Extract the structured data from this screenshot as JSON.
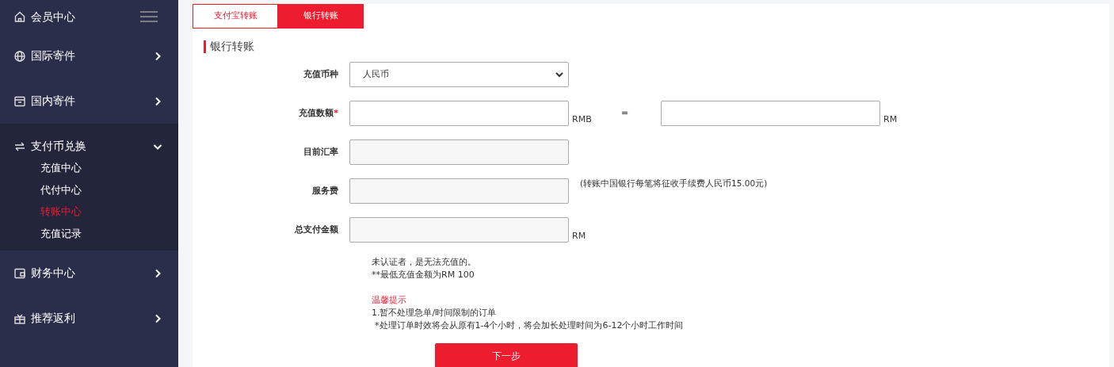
{
  "sidebar": {
    "header": {
      "label": "会员中心"
    },
    "items": [
      {
        "label": "国际寄件",
        "expanded": false
      },
      {
        "label": "国内寄件",
        "expanded": false
      },
      {
        "label": "支付币兑换",
        "expanded": true,
        "children": [
          {
            "label": "充值中心",
            "selected": false
          },
          {
            "label": "代付中心",
            "selected": false
          },
          {
            "label": "转账中心",
            "selected": true
          },
          {
            "label": "充值记录",
            "selected": false
          }
        ]
      },
      {
        "label": "财务中心",
        "expanded": false
      },
      {
        "label": "推荐返利",
        "expanded": false
      }
    ]
  },
  "tabs": [
    {
      "label": "支付宝转账",
      "selected": false
    },
    {
      "label": "银行转账",
      "selected": true
    }
  ],
  "section_title": "银行转账",
  "form": [
    {
      "kind": "select",
      "label": "充值币种",
      "value": "人民币"
    },
    {
      "kind": "conversion",
      "label": "充值数额",
      "required_mark": "*",
      "unit": "RMB",
      "equals": "=",
      "target_unit": "RM"
    },
    {
      "kind": "readonly",
      "label": "目前汇率"
    },
    {
      "kind": "readonly",
      "label": "服务费",
      "note": "(转账中国银行每笔将征收手续费人民币15.00元)"
    },
    {
      "kind": "readonly",
      "label": "总支付金额",
      "unit": "RM"
    }
  ],
  "requirements": [
    "未认证者，是无法充值的。",
    "**最低充值金额为RM 100"
  ],
  "tips": {
    "title": "温馨提示",
    "lines": [
      "1.暂不处理急单/时间限制的订单",
      "*处理订单时效将会从原有1-4个小时，将会加长处理时间为6-12个小时工作时间"
    ]
  },
  "submit": "下一步"
}
